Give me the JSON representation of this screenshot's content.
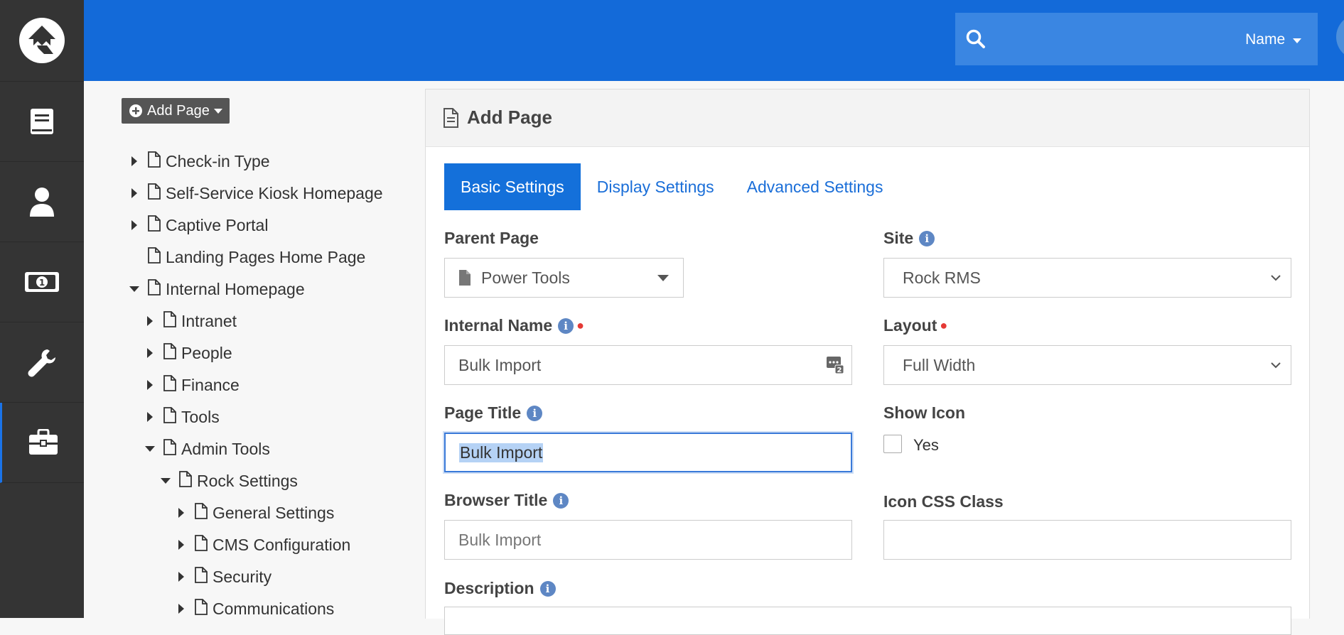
{
  "app": {
    "search_type": "Name"
  },
  "leftnav": {
    "items": [
      {
        "icon": "book-icon"
      },
      {
        "icon": "person-icon"
      },
      {
        "icon": "money-icon"
      },
      {
        "icon": "wrench-icon"
      },
      {
        "icon": "briefcase-icon"
      }
    ]
  },
  "tree": {
    "add_label": "Add Page",
    "items": [
      {
        "label": "Check-in Type",
        "state": "collapsed"
      },
      {
        "label": "Self-Service Kiosk Homepage",
        "state": "collapsed"
      },
      {
        "label": "Captive Portal",
        "state": "collapsed"
      },
      {
        "label": "Landing Pages Home Page",
        "state": "none"
      },
      {
        "label": "Internal Homepage",
        "state": "expanded"
      },
      {
        "label": "Intranet",
        "state": "collapsed"
      },
      {
        "label": "People",
        "state": "collapsed"
      },
      {
        "label": "Finance",
        "state": "collapsed"
      },
      {
        "label": "Tools",
        "state": "collapsed"
      },
      {
        "label": "Admin Tools",
        "state": "expanded"
      },
      {
        "label": "Rock Settings",
        "state": "expanded"
      },
      {
        "label": "General Settings",
        "state": "collapsed"
      },
      {
        "label": "CMS Configuration",
        "state": "collapsed"
      },
      {
        "label": "Security",
        "state": "collapsed"
      },
      {
        "label": "Communications",
        "state": "collapsed"
      }
    ]
  },
  "panel": {
    "title": "Add Page",
    "tabs": [
      "Basic Settings",
      "Display Settings",
      "Advanced Settings"
    ],
    "parent_page": {
      "label": "Parent Page",
      "value": "Power Tools"
    },
    "site": {
      "label": "Site",
      "value": "Rock RMS"
    },
    "internal_name": {
      "label": "Internal Name",
      "value": "Bulk Import"
    },
    "layout": {
      "label": "Layout",
      "value": "Full Width"
    },
    "page_title": {
      "label": "Page Title",
      "value": "Bulk Import"
    },
    "show_icon": {
      "label": "Show Icon",
      "option": "Yes"
    },
    "browser_title": {
      "label": "Browser Title",
      "placeholder": "Bulk Import"
    },
    "icon_css": {
      "label": "Icon CSS Class",
      "value": ""
    },
    "description": {
      "label": "Description"
    }
  },
  "colors": {
    "header_blue": "#136ad9",
    "nav_dark": "#343434",
    "accent": "#1470da",
    "required": "#e53935"
  }
}
